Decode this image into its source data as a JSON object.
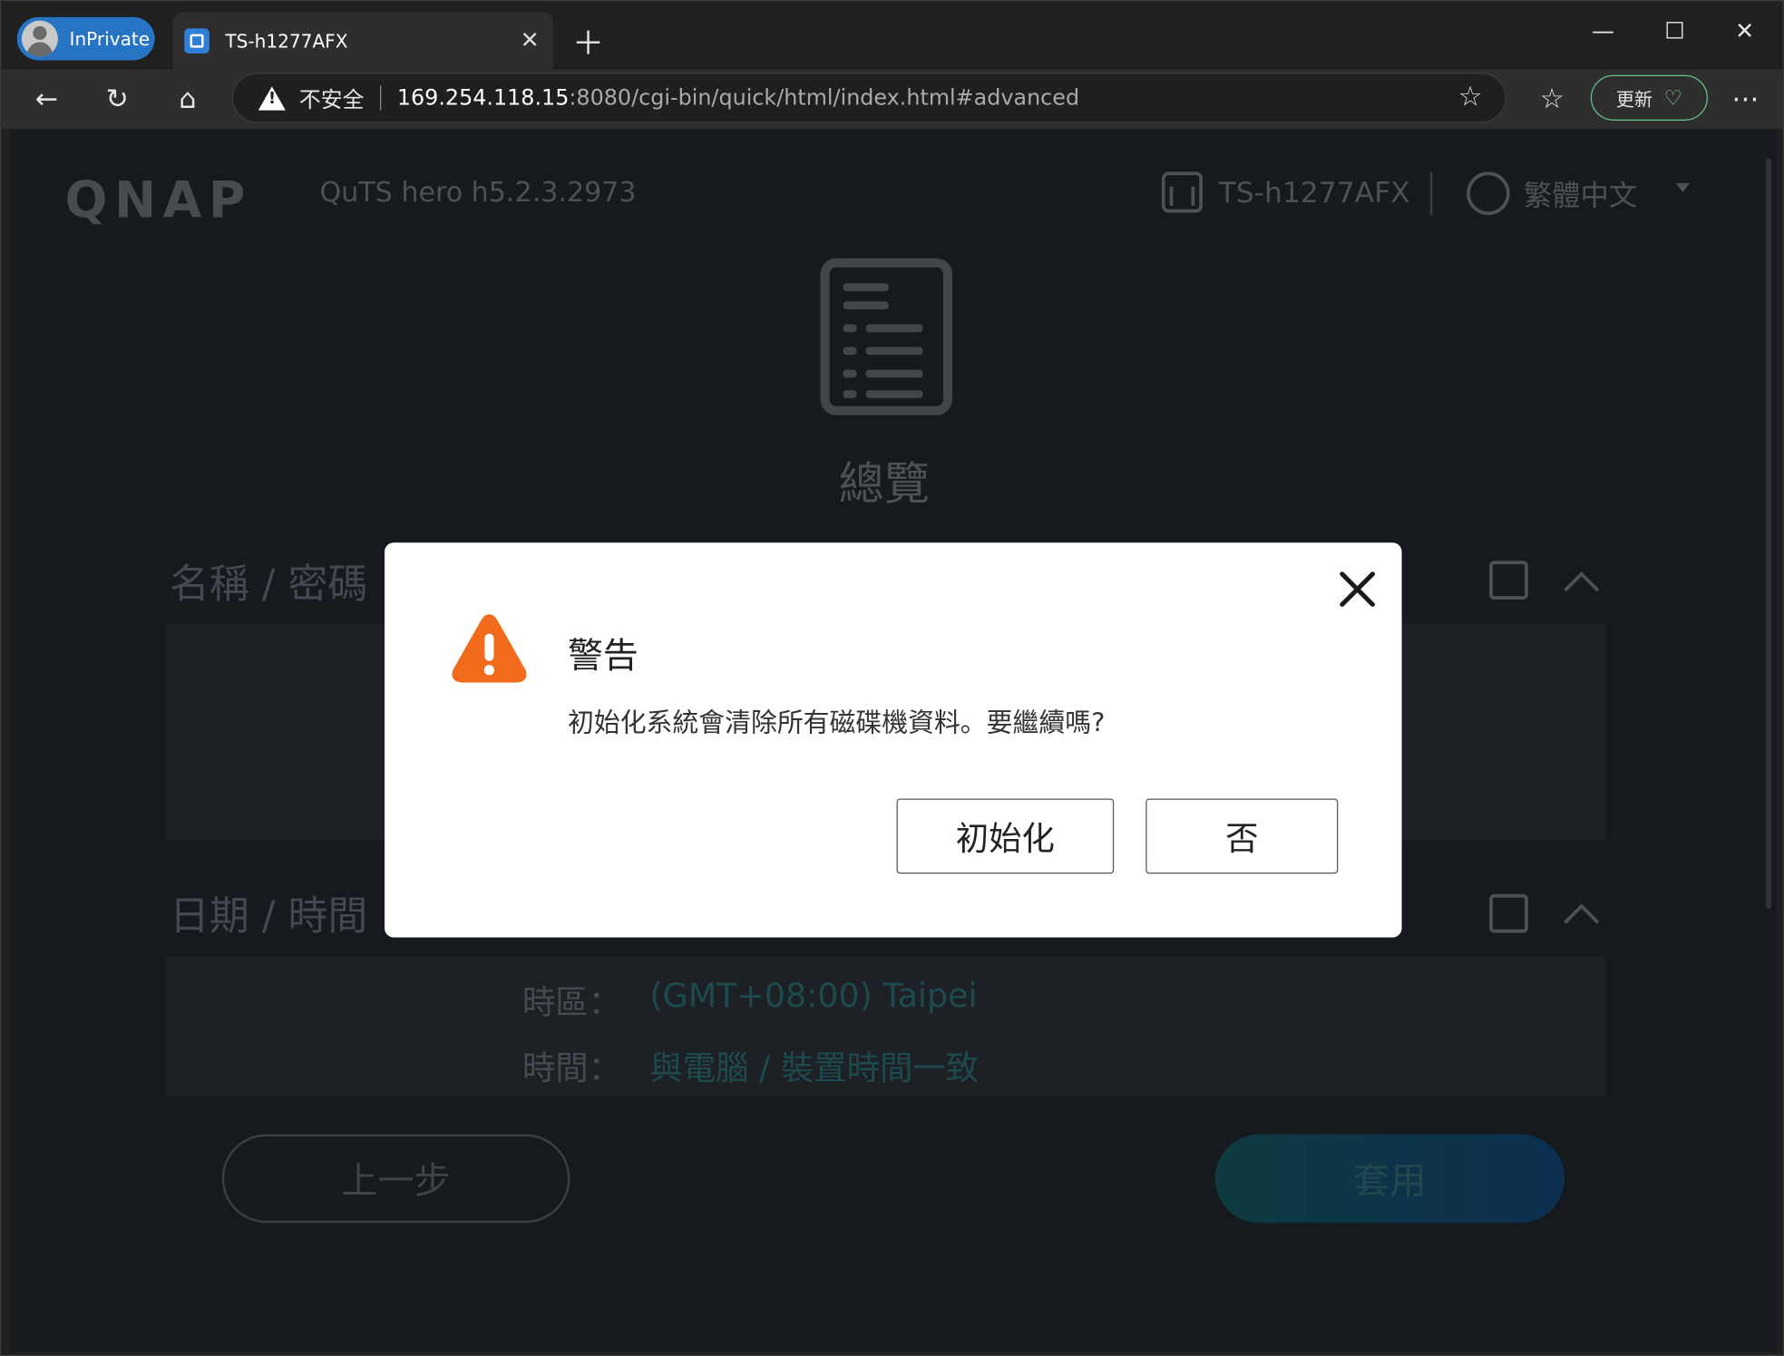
{
  "browser": {
    "inprivate_label": "InPrivate",
    "tab_title": "TS-h1277AFX",
    "insecure_label": "不安全",
    "url_host": "169.254.118.15",
    "url_path": ":8080/cgi-bin/quick/html/index.html#advanced",
    "update_label": "更新",
    "icons": [
      "back-icon",
      "refresh-icon",
      "home-icon",
      "star-icon",
      "favorites-icon",
      "menu-icon"
    ]
  },
  "header": {
    "logo": "QNAP",
    "version": "QuTS hero h5.2.3.2973",
    "device": "TS-h1277AFX",
    "language": "繁體中文"
  },
  "overview": {
    "title": "總覽"
  },
  "sections": {
    "name_password": "名稱 / 密碼",
    "date_time": "日期 / 時間"
  },
  "datetime": {
    "tz_label": "時區：",
    "tz_value": "(GMT+08:00) Taipei",
    "time_label": "時間：",
    "time_value": "與電腦 / 裝置時間一致"
  },
  "footer": {
    "prev_label": "上一步",
    "apply_label": "套用"
  },
  "dialog": {
    "title": "警告",
    "message": "初始化系統會清除所有磁碟機資料。要繼續嗎?",
    "confirm_label": "初始化",
    "cancel_label": "否"
  },
  "colors": {
    "warning": "#f26b1d",
    "accent": "#0f3d44"
  }
}
